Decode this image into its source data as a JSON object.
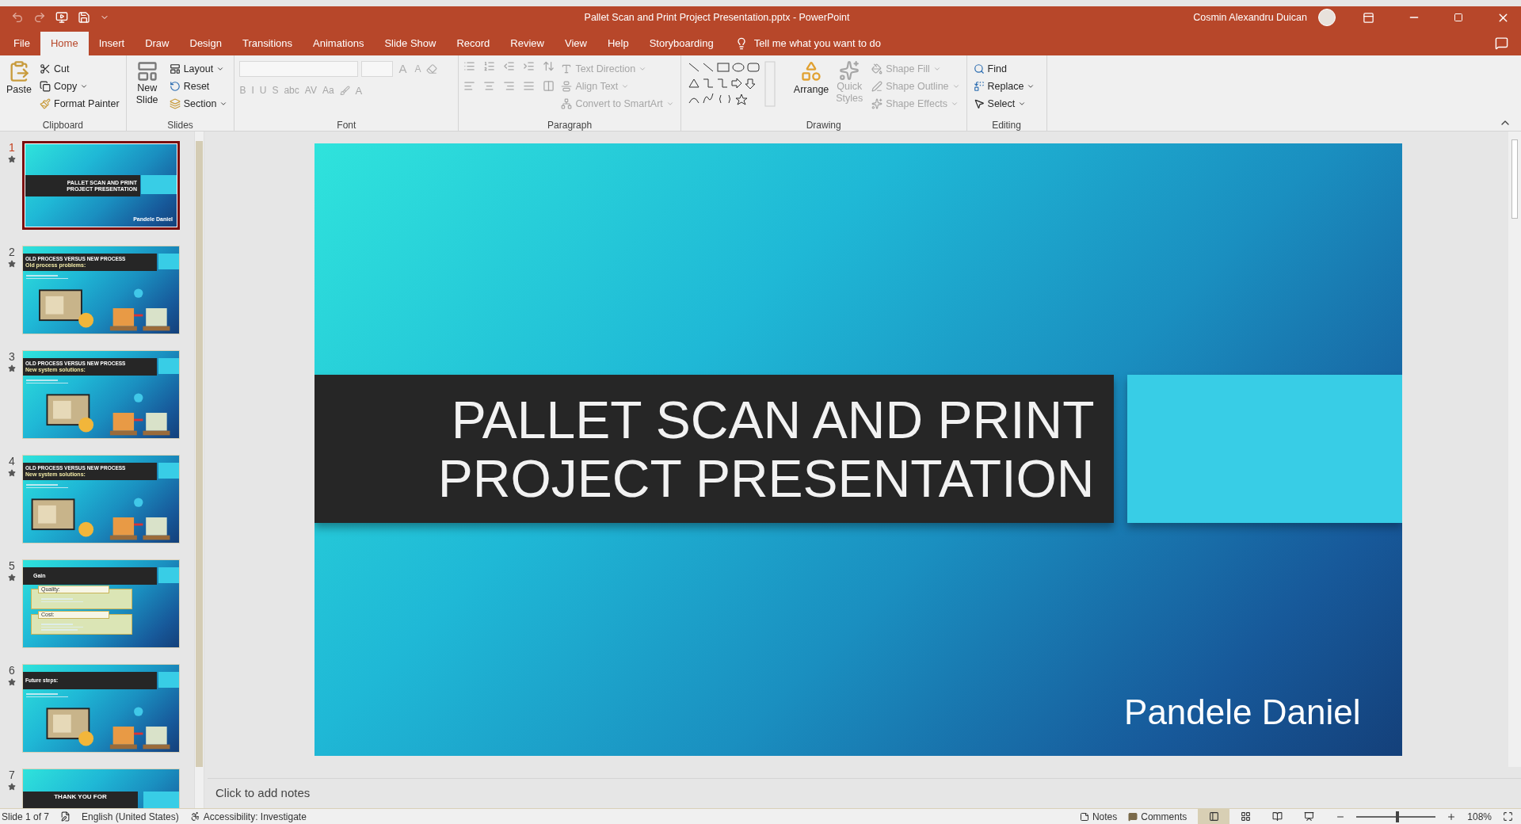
{
  "window": {
    "title": "Pallet Scan and Print Project Presentation.pptx  -  PowerPoint",
    "user": "Cosmin Alexandru Duican"
  },
  "ribbon_tabs": [
    {
      "label": "File",
      "selected": false
    },
    {
      "label": "Home",
      "selected": true
    },
    {
      "label": "Insert",
      "selected": false
    },
    {
      "label": "Draw",
      "selected": false
    },
    {
      "label": "Design",
      "selected": false
    },
    {
      "label": "Transitions",
      "selected": false
    },
    {
      "label": "Animations",
      "selected": false
    },
    {
      "label": "Slide Show",
      "selected": false
    },
    {
      "label": "Record",
      "selected": false
    },
    {
      "label": "Review",
      "selected": false
    },
    {
      "label": "View",
      "selected": false
    },
    {
      "label": "Help",
      "selected": false
    },
    {
      "label": "Storyboarding",
      "selected": false
    }
  ],
  "tell_me": "Tell me what you want to do",
  "clipboard": {
    "label": "Clipboard",
    "paste": "Paste",
    "cut": "Cut",
    "copy": "Copy",
    "format_painter": "Format Painter"
  },
  "slides_group": {
    "label": "Slides",
    "new_slide": "New Slide",
    "layout": "Layout",
    "reset": "Reset",
    "section": "Section"
  },
  "font": {
    "label": "Font",
    "size_buttons": [
      "A",
      "A"
    ],
    "style_buttons": [
      "B",
      "I",
      "U",
      "S",
      "abc",
      "AV",
      "Aa"
    ],
    "color_button": "A"
  },
  "paragraph": {
    "label": "Paragraph",
    "commands": [
      {
        "label": "Text Direction",
        "disabled": true
      },
      {
        "label": "Align Text",
        "disabled": true
      },
      {
        "label": "Convert to SmartArt",
        "disabled": true
      }
    ]
  },
  "drawing": {
    "label": "Drawing",
    "arrange": {
      "label": "Arrange",
      "disabled": false
    },
    "quick_styles": {
      "label": "Quick Styles",
      "disabled": true
    },
    "commands": [
      {
        "label": "Shape Fill",
        "disabled": true
      },
      {
        "label": "Shape Outline",
        "disabled": true
      },
      {
        "label": "Shape Effects",
        "disabled": true
      }
    ]
  },
  "editing": {
    "label": "Editing",
    "commands": [
      {
        "label": "Find",
        "disabled": false
      },
      {
        "label": "Replace",
        "disabled": false
      },
      {
        "label": "Select",
        "disabled": false
      }
    ]
  },
  "thumbnails": [
    {
      "number": "1",
      "selected": true,
      "kind": "title",
      "title": "PALLET SCAN AND PRINT PROJECT PRESENTATION",
      "subtitle": "Pandele Daniel"
    },
    {
      "number": "2",
      "selected": false,
      "kind": "content",
      "title": "OLD PROCESS VERSUS NEW PROCESS",
      "subtitle": "Old process problems:"
    },
    {
      "number": "3",
      "selected": false,
      "kind": "content",
      "title": "OLD PROCESS VERSUS NEW PROCESS",
      "subtitle": "New system solutions:"
    },
    {
      "number": "4",
      "selected": false,
      "kind": "content",
      "title": "OLD PROCESS VERSUS NEW PROCESS",
      "subtitle": "New system solutions:"
    },
    {
      "number": "5",
      "selected": false,
      "kind": "boxes",
      "title": "Gain",
      "boxes": [
        "Quality:",
        "Cost:"
      ]
    },
    {
      "number": "6",
      "selected": false,
      "kind": "content",
      "title": "Future steps:"
    },
    {
      "number": "7",
      "selected": false,
      "kind": "closing",
      "title": "THANK YOU FOR"
    }
  ],
  "slide": {
    "title_lines": [
      "PALLET SCAN AND PRINT",
      "PROJECT PRESENTATION"
    ],
    "subtitle": "Pandele Daniel"
  },
  "notes": {
    "placeholder": "Click to add notes"
  },
  "status_bar": {
    "slide": "Slide 1 of 7",
    "language": "English (United States)",
    "accessibility": "Accessibility: Investigate",
    "notes": "Notes",
    "comments": "Comments",
    "views": [
      {
        "selected": true
      },
      {
        "selected": false
      },
      {
        "selected": false
      },
      {
        "selected": false
      }
    ],
    "zoom": {
      "level": 0.52,
      "reading": "108%"
    }
  }
}
